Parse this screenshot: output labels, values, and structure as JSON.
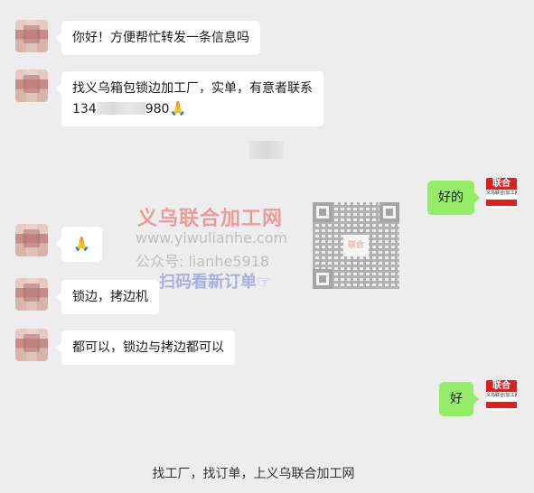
{
  "messages": [
    {
      "side": "left",
      "text": "你好！方便帮忙转发一条信息吗"
    },
    {
      "side": "left",
      "line1": "找义乌箱包锁边加工厂，实单，有意者联系",
      "phone_start": "134",
      "phone_end": "980"
    },
    {
      "side": "right",
      "text": "好的"
    },
    {
      "side": "left",
      "emoji": "🙏"
    },
    {
      "side": "left",
      "text": "锁边，拷边机"
    },
    {
      "side": "left",
      "text": "都可以，锁边与拷边都可以"
    },
    {
      "side": "right",
      "text": "好"
    }
  ],
  "logo_avatar": {
    "top": "联合",
    "mid": "义乌联合|加工网"
  },
  "watermark": {
    "title": "义乌联合加工网",
    "url": "www.yiwulianhe.com",
    "wechat": "公众号: lianhe5918",
    "scan": "扫码看新订单☞",
    "qr_center": "联合"
  },
  "footer": "找工厂，找订单，上义乌联合加工网"
}
